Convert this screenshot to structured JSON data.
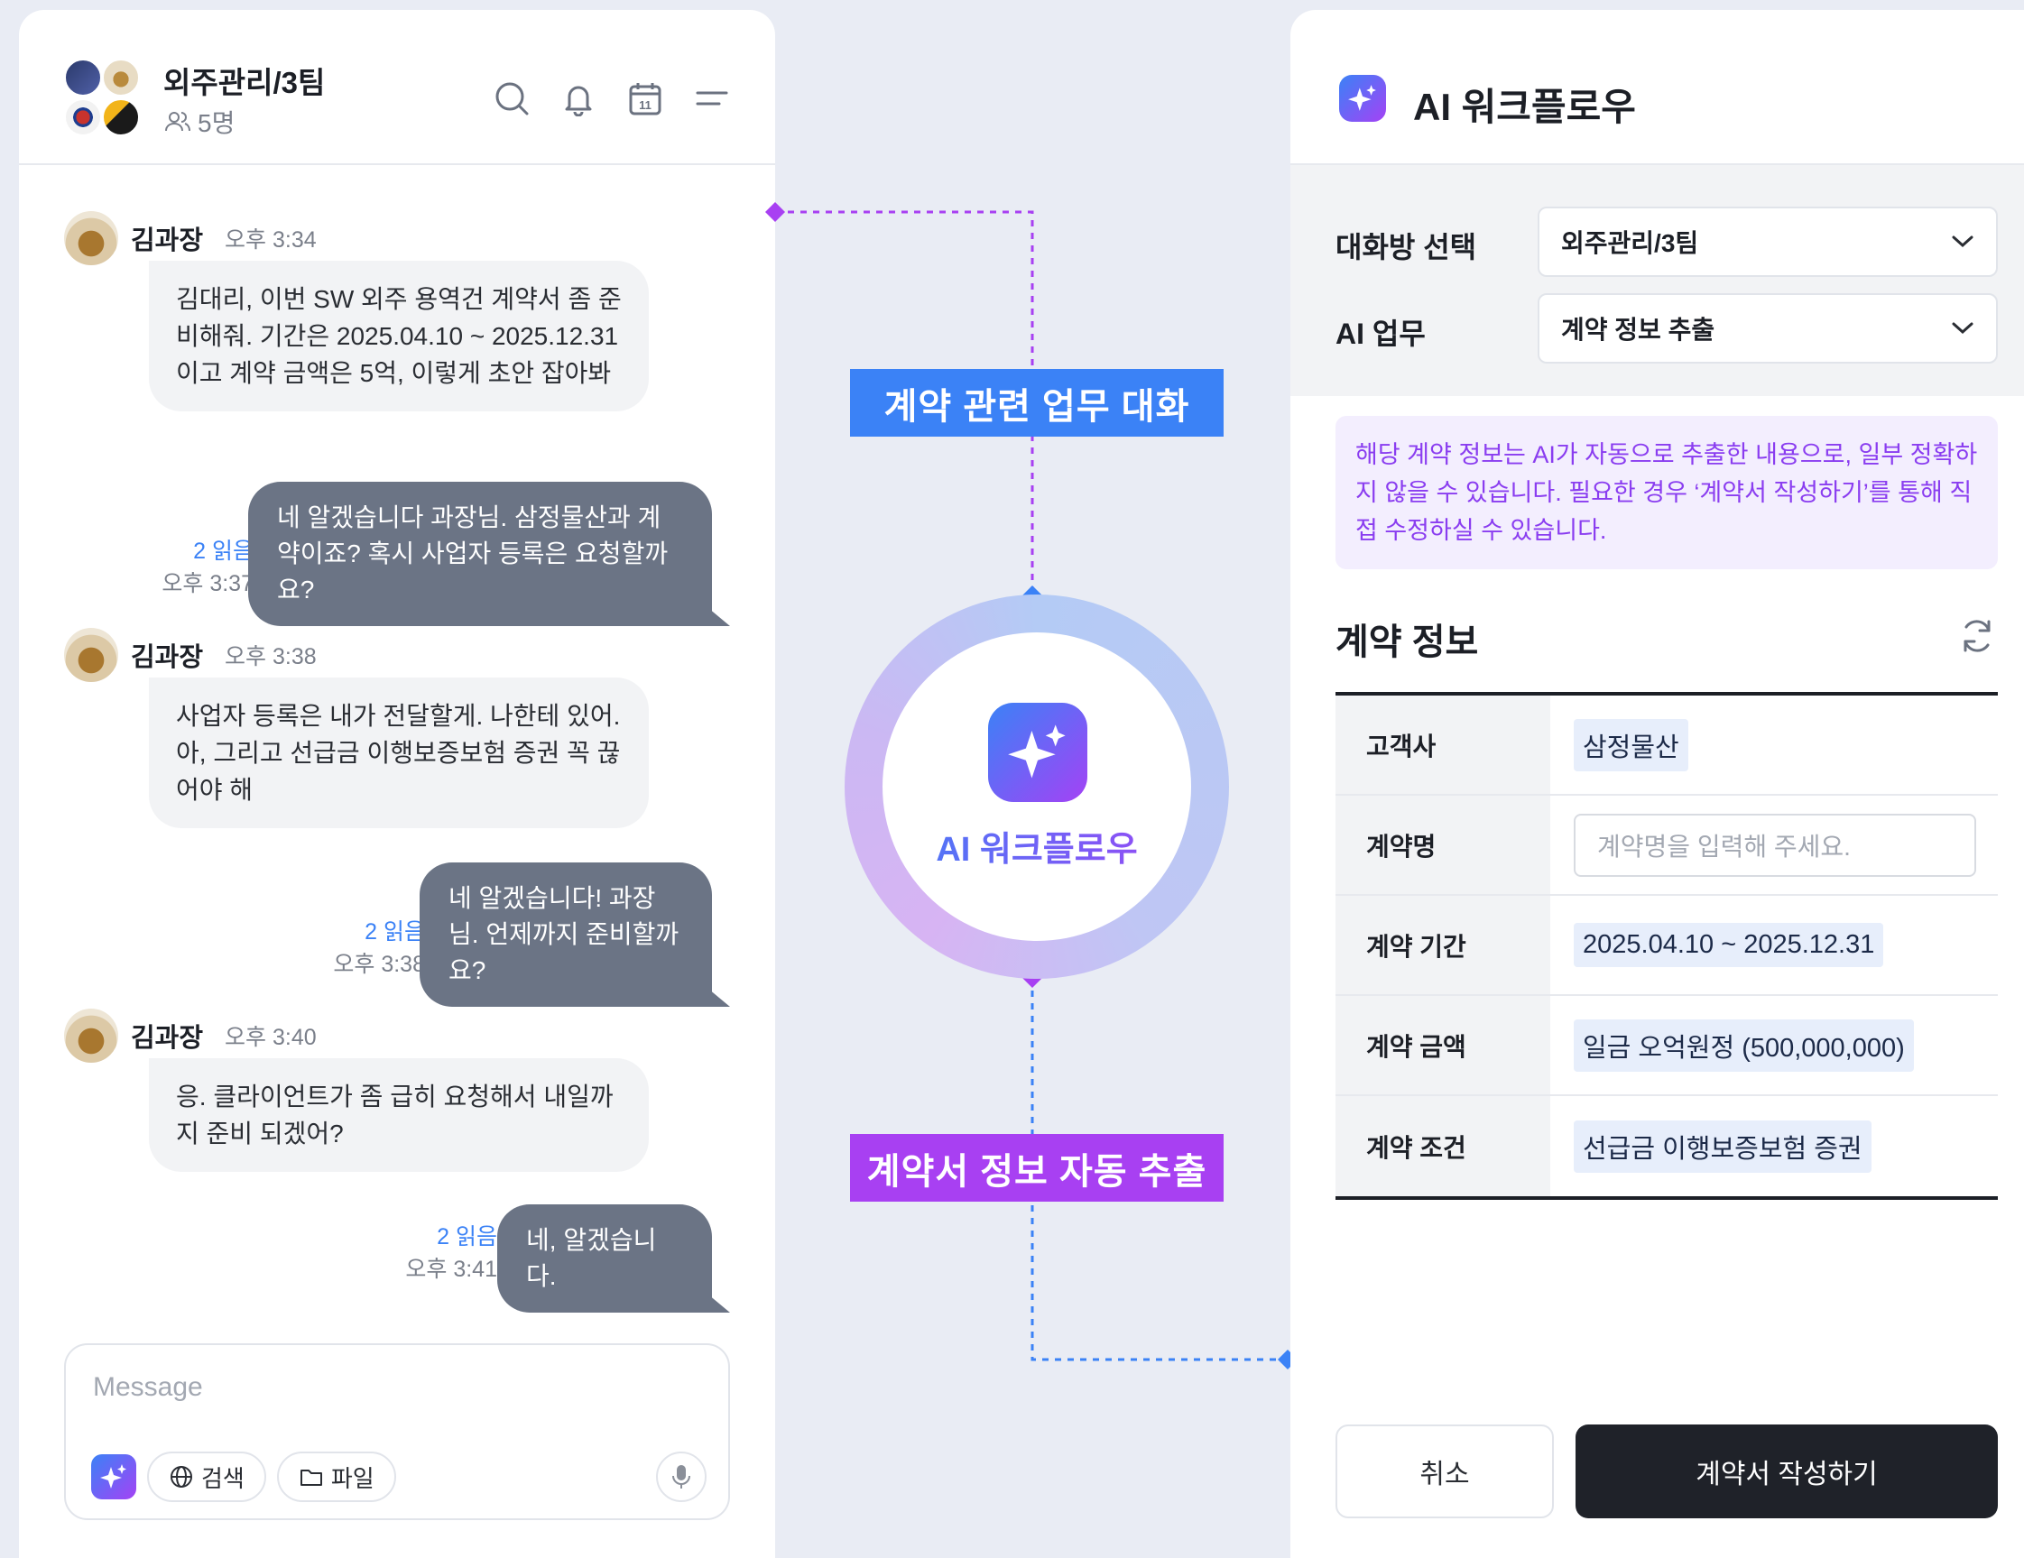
{
  "chat": {
    "group_name": "외주관리/3팀",
    "member_count": "5명",
    "messages": [
      {
        "sender": "김과장",
        "time": "오후 3:34",
        "text": "김대리, 이번 SW 외주 용역건 계약서 좀 준비해줘. 기간은 2025.04.10 ~ 2025.12.31 이고 계약 금액은 5억, 이렇게 초안 잡아봐"
      },
      {
        "reads": "2 읽음",
        "time": "오후 3:37",
        "text": "네 알겠습니다 과장님. 삼정물산과 계약이죠? 혹시 사업자 등록은 요청할까요?"
      },
      {
        "sender": "김과장",
        "time": "오후 3:38",
        "text": "사업자 등록은 내가 전달할게. 나한테 있어. 아, 그리고 선급금 이행보증보험 증권 꼭 끊어야 해"
      },
      {
        "reads": "2 읽음",
        "time": "오후 3:38",
        "text": "네 알겠습니다! 과장님. 언제까지 준비할까요?"
      },
      {
        "sender": "김과장",
        "time": "오후 3:40",
        "text": "응. 클라이언트가 좀 급히 요청해서 내일까지 준비 되겠어?"
      },
      {
        "reads": "2 읽음",
        "time": "오후 3:41",
        "text": "네, 알겠습니다."
      }
    ],
    "composer": {
      "placeholder": "Message",
      "search_label": "검색",
      "file_label": "파일"
    }
  },
  "flow": {
    "top_label": "계약 관련 업무 대화",
    "bottom_label": "계약서 정보 자동 추출",
    "center_title": "AI 워크플로우",
    "colors": {
      "blue": "#3b82f6",
      "purple": "#a840f2"
    }
  },
  "workflow": {
    "title": "AI 워크플로우",
    "room_label": "대화방 선택",
    "room_value": "외주관리/3팀",
    "task_label": "AI 업무",
    "task_value": "계약 정보 추출",
    "notice": "해당 계약 정보는 AI가 자동으로 추출한 내용으로, 일부 정확하지 않을 수 있습니다. 필요한 경우 ‘계약서 작성하기’를 통해 직접 수정하실 수 있습니다.",
    "info_title": "계약 정보",
    "rows": [
      {
        "key": "고객사",
        "value": "삼정물산"
      },
      {
        "key": "계약명",
        "placeholder": "계약명을 입력해 주세요."
      },
      {
        "key": "계약 기간",
        "value": "2025.04.10 ~ 2025.12.31"
      },
      {
        "key": "계약 금액",
        "value": "일금 오억원정 (500,000,000)"
      },
      {
        "key": "계약 조건",
        "value": "선급금 이행보증보험 증권"
      }
    ],
    "cancel_label": "취소",
    "submit_label": "계약서 작성하기"
  }
}
